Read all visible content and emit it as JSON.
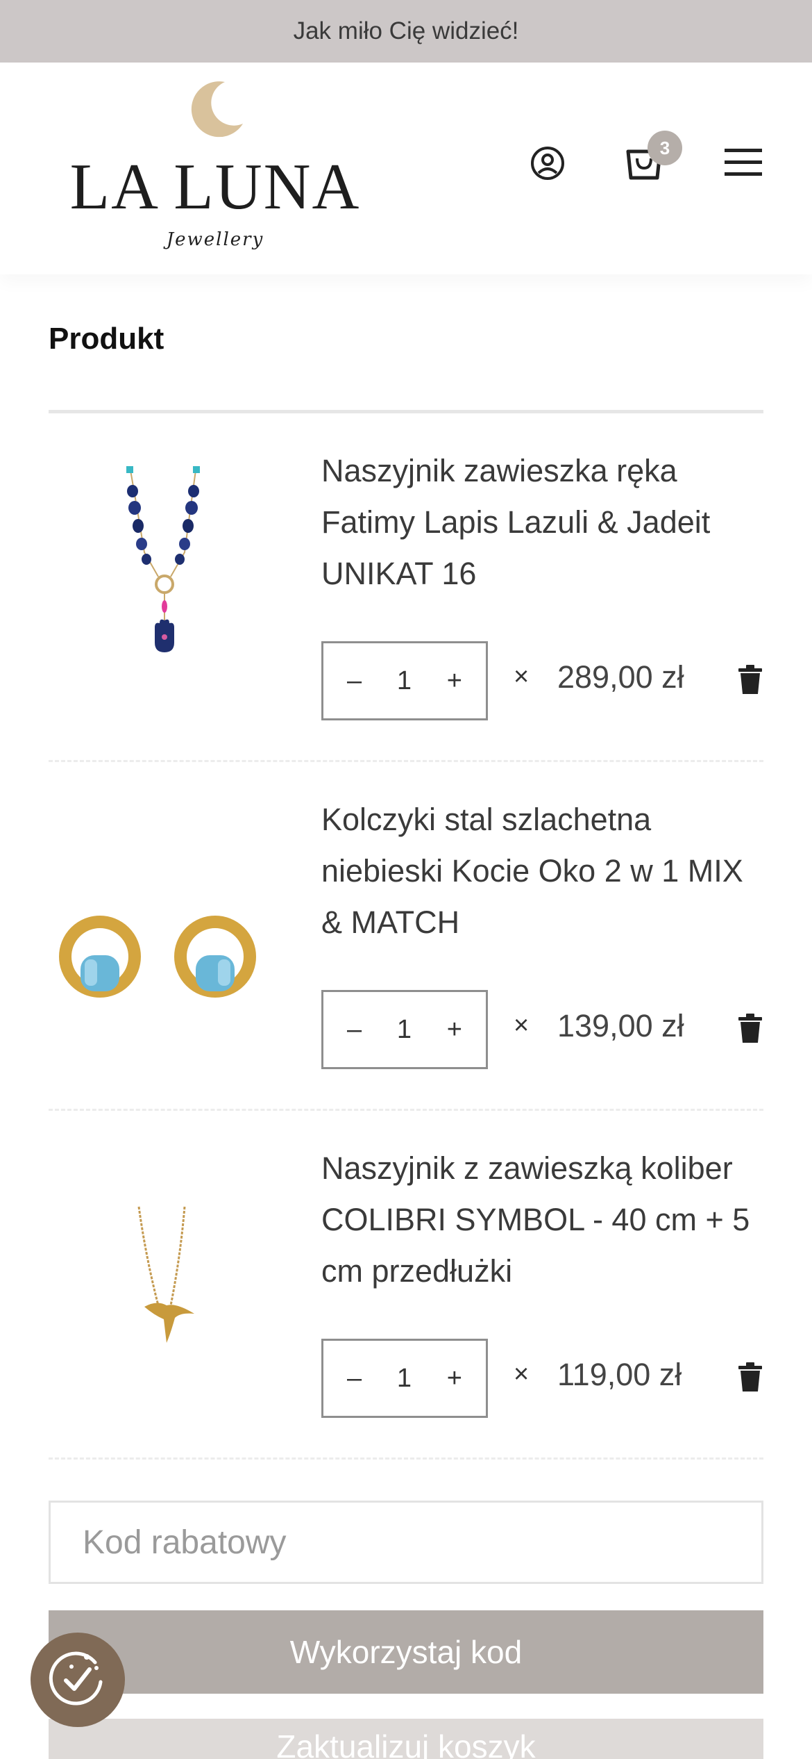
{
  "announcement": "Jak miło Cię widzieć!",
  "brand": {
    "name": "LA LUNA",
    "tagline": "Jewellery"
  },
  "header": {
    "cart_count": "3"
  },
  "cart": {
    "column_header": "Produkt",
    "items": [
      {
        "name": "Naszyjnik zawieszka ręka Fatimy Lapis Lazuli & Jadeit UNIKAT 16",
        "qty": "1",
        "price": "289,00 zł"
      },
      {
        "name": "Kolczyki stal szlachetna niebieski Kocie Oko 2 w 1 MIX & MATCH",
        "qty": "1",
        "price": "139,00 zł"
      },
      {
        "name": "Naszyjnik z zawieszką koliber COLIBRI SYMBOL - 40 cm + 5 cm przedłużki",
        "qty": "1",
        "price": "119,00 zł"
      }
    ],
    "qty_minus": "–",
    "qty_plus": "+",
    "times": "×"
  },
  "coupon": {
    "placeholder": "Kod rabatowy"
  },
  "buttons": {
    "apply": "Wykorzystaj kod",
    "update": "Zaktualizuj koszyk"
  },
  "colors": {
    "topbar": "#ccc7c7",
    "apply_button": "#b2aca8",
    "badge": "#b5aea9",
    "cookie": "#806a56"
  },
  "icons": [
    "moon-icon",
    "account-icon",
    "cart-icon",
    "menu-icon",
    "trash-icon",
    "cookie-icon"
  ]
}
